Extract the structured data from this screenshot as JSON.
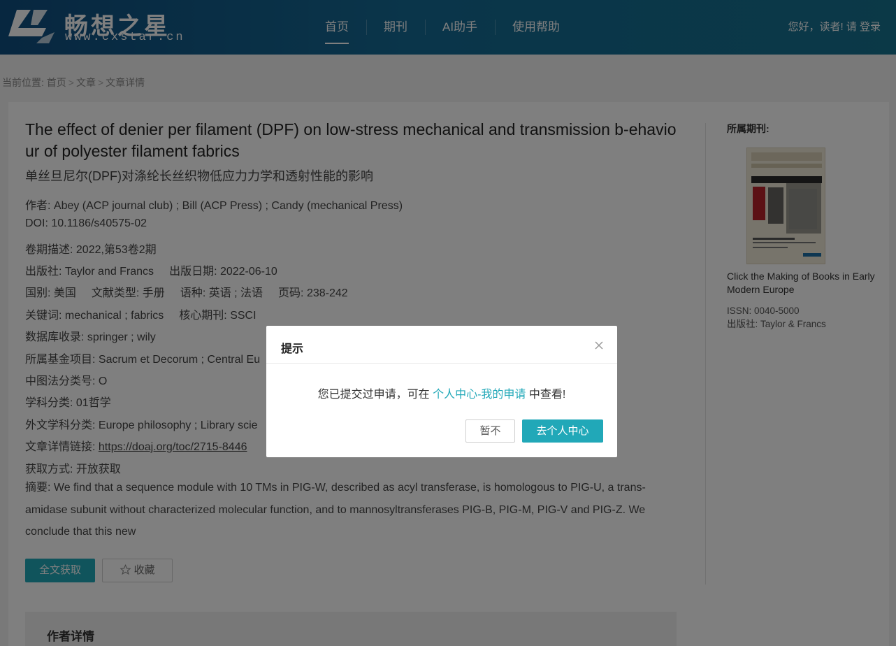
{
  "header": {
    "logo_title": "畅想之星",
    "logo_url": "www.cxstar.cn",
    "nav": [
      {
        "label": "首页",
        "active": true
      },
      {
        "label": "期刊",
        "active": false
      },
      {
        "label": "AI助手",
        "active": false
      },
      {
        "label": "使用帮助",
        "active": false
      }
    ],
    "greeting": "您好，读者!",
    "login": "请 登录"
  },
  "breadcrumb": {
    "prefix": "当前位置:",
    "items": [
      "首页",
      "文章",
      "文章详情"
    ],
    "separator": ">"
  },
  "article": {
    "title_en": "The effect of denier per filament (DPF) on low-stress mechanical and transmission b-ehaviour of polyester filament fabrics",
    "title_cn": "单丝旦尼尔(DPF)对涤纶长丝织物低应力力学和透射性能的影响",
    "authors": "作者: Abey (ACP journal club) ; Bill (ACP Press) ; Candy (mechanical Press)",
    "doi": "DOI: 10.1186/s40575-02",
    "volume": "卷期描述: 2022,第53卷2期",
    "publisher": "出版社: Taylor and Francs",
    "pub_date": "出版日期: 2022-06-10",
    "country": "国别: 美国",
    "doc_type": "文献类型: 手册",
    "language": "语种: 英语 ; 法语",
    "pages": "页码: 238-242",
    "keywords": "关键词: mechanical ; fabrics",
    "core_journal": "核心期刊: SSCI",
    "database": "数据库收录: springer ; wily",
    "fund": "所属基金项目: Sacrum et Decorum ; Central Eu",
    "clc": "中图法分类号: O",
    "subject": "学科分类: 01哲学",
    "foreign_subject": "外文学科分类: Europe philosophy ; Library scie",
    "link_label": "文章详情链接: ",
    "link_url": "https://doaj.org/toc/2715-8446",
    "access": "获取方式: 开放获取",
    "abstract": "摘要: We find that a sequence module with 10 TMs in PIG-W, described as acyl transferase, is homologous to PIG-U, a trans-amidase subunit without characterized molecular function, and to mannosyltransferases PIG-B, PIG-M, PIG-V and PIG-Z. We conclude that this new",
    "btn_full": "全文获取",
    "btn_fav": "收藏",
    "author_section_title": "作者详情"
  },
  "sidebar": {
    "title": "所属期刊:",
    "journal_name": "Click the Making of Books in Early Modern Europe",
    "issn": "ISSN: 0040-5000",
    "publisher": "出版社:  Taylor & Francs",
    "cover": {
      "line1": "INKY",
      "line2": "FINGERS",
      "line3": "THE MAKING OF BOOKS IN EARLY MODERN EUROPE",
      "cn_title": "染墨的指尖"
    }
  },
  "modal": {
    "title": "提示",
    "msg_before": "您已提交过申请，可在 ",
    "msg_link": "个人中心-我的申请",
    "msg_after": " 中查看!",
    "btn_cancel": "暂不",
    "btn_confirm": "去个人中心"
  },
  "colors": {
    "accent": "#21a8b8",
    "header_start": "#0f4e80",
    "header_end": "#16728f"
  }
}
